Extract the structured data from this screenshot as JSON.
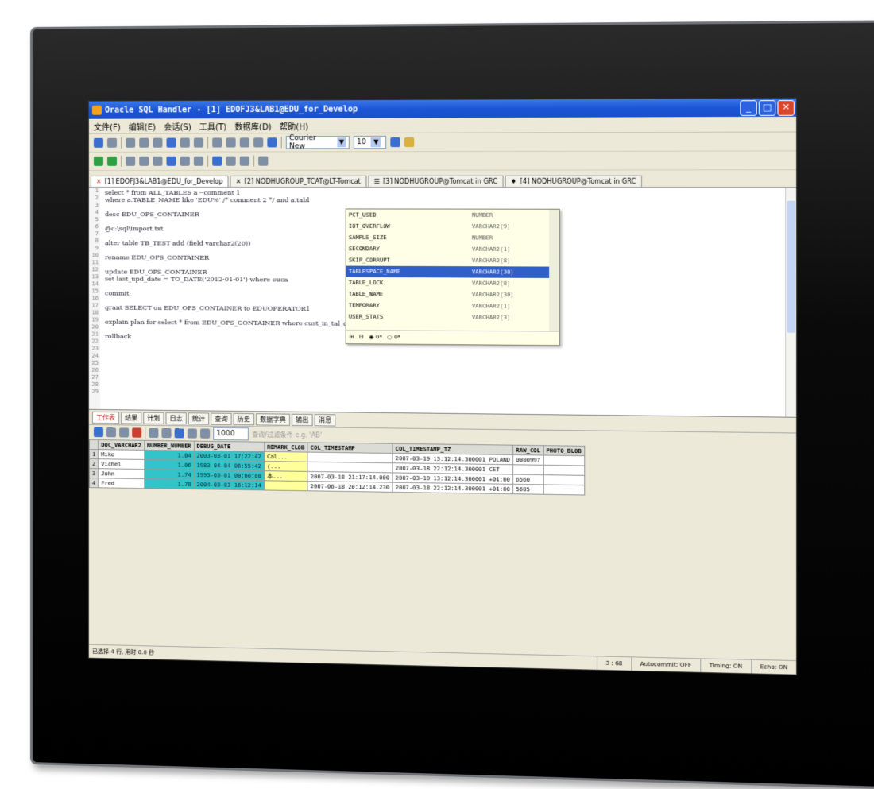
{
  "window": {
    "title": "Oracle SQL Handler - [1] EDOFJ3&LAB1@EDU_for_Develop"
  },
  "menu": [
    "文件(F)",
    "编辑(E)",
    "会话(S)",
    "工具(T)",
    "数据库(D)",
    "帮助(H)"
  ],
  "toolbar": {
    "font_name": "Courier New",
    "font_size": "10"
  },
  "tabs": [
    {
      "label": "[1] EDOFJ3&LAB1@EDU_for_Develop",
      "active": true
    },
    {
      "label": "[2] NODHUGROUP_TCAT@LT-Tomcat",
      "active": false
    },
    {
      "label": "[3] NODHUGROUP@Tomcat in GRC",
      "active": false
    },
    {
      "label": "[4] NODHUGROUP@Tomcat in GRC",
      "active": false
    }
  ],
  "editor": {
    "line_numbers": [
      "1",
      "2",
      "3",
      "4",
      "5",
      "6",
      "7",
      "8",
      "9",
      "10",
      "11",
      "12",
      "13",
      "14",
      "15",
      "16",
      "17",
      "18",
      "19",
      "20",
      "21",
      "22",
      "23",
      "24",
      "25",
      "26",
      "27",
      "28",
      "29"
    ],
    "lines": [
      "select * from ALL_TABLES a --comment 1",
      "where a.TABLE_NAME like 'EDU%' /* comment 2 */ and a.tabl",
      "",
      "desc EDU_OPS_CONTAINER",
      "",
      "@c:\\sql\\import.txt",
      "",
      "alter table TB_TEST add (field varchar2(20))",
      "",
      "rename EDU_OPS_CONTAINER",
      "",
      "update EDU_OPS_CONTAINER",
      "set last_upd_date = TO_DATE('2012-01-01') where ouca",
      "",
      "commit;",
      "",
      "grant SELECT on EDU_OPS_CONTAINER to EDUOPERATOR1",
      "",
      "explain plan for select * from EDU_OPS_CONTAINER where cust_in_tal_datetime > TO_DATE('2012-01-01')",
      "",
      "rollback"
    ]
  },
  "autocomplete": {
    "items": [
      {
        "name": "PCT_USED",
        "type": "NUMBER"
      },
      {
        "name": "IOT_OVERFLOW",
        "type": "VARCHAR2(9)"
      },
      {
        "name": "SAMPLE_SIZE",
        "type": "NUMBER"
      },
      {
        "name": "SECONDARY",
        "type": "VARCHAR2(1)"
      },
      {
        "name": "SKIP_CORRUPT",
        "type": "VARCHAR2(8)"
      },
      {
        "name": "TABLESPACE_NAME",
        "type": "VARCHAR2(30)",
        "selected": true
      },
      {
        "name": "TABLE_LOCK",
        "type": "VARCHAR2(8)"
      },
      {
        "name": "TABLE_NAME",
        "type": "VARCHAR2(30)"
      },
      {
        "name": "TEMPORARY",
        "type": "VARCHAR2(1)"
      },
      {
        "name": "USER_STATS",
        "type": "VARCHAR2(3)"
      }
    ],
    "footer_opt1": "0*",
    "footer_opt2": "0*"
  },
  "result_tabs": [
    "工作表",
    "结果",
    "计划",
    "日志",
    "统计",
    "查询",
    "历史",
    "数据字典",
    "输出",
    "消息"
  ],
  "grid_toolbar": {
    "count_value": "1000",
    "hint": "查询/过滤条件 e.g. 'AB'"
  },
  "grid": {
    "columns": [
      "DOC_VARCHAR2",
      "NUMBER_NUMBER",
      "DEBUG_DATE",
      "REMARK_CLOB",
      "COL_TIMESTAMP",
      "COL_TIMESTAMP_TZ",
      "RAW_COL",
      "PHOTO_BLOB"
    ],
    "rows": [
      [
        "Mike",
        "1.04",
        "2003-03-01 17:22:42",
        "Cal...",
        "",
        "2007-03-19 13:12:14.300001 POLAND",
        "",
        ""
      ],
      [
        "Vichel",
        "1.06",
        "1983-04-04 06:55:42",
        "(...",
        "",
        "2007-03-18 22:12:14.300001 CET",
        "",
        ""
      ],
      [
        "John",
        "1.74",
        "1993-03-01 00:00:00",
        "本...",
        "2007-03-18 21:17:14.000",
        "2007-03-19 13:12:14.300001 +01:00",
        "6560",
        ""
      ],
      [
        "Fred",
        "1.78",
        "2004-03-03 16:12:14",
        "",
        "2007-06-18 20:12:14.230",
        "2007-03-18 22:12:14.300001 +01:00",
        "5605",
        ""
      ]
    ],
    "raw_col_r0": "0000997"
  },
  "status": {
    "left": "已选择 4 行, 用时 0.0 秒",
    "position": "3 : 68",
    "autocommit": "Autocommit: OFF",
    "timing": "Timing: ON",
    "other": "Echo: ON"
  }
}
